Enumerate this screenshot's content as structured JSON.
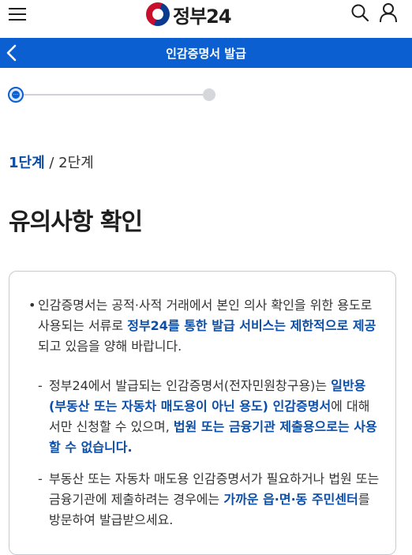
{
  "header": {
    "logo_text": "정부24",
    "menu_icon": "hamburger-menu-icon",
    "search_icon": "search-icon",
    "user_icon": "user-icon"
  },
  "titlebar": {
    "title": "인감증명서 발급",
    "back_icon": "chevron-left-icon"
  },
  "stepper": {
    "current_step": 1,
    "total_steps": 2,
    "current_symbol": "···"
  },
  "step_indicator": {
    "current": "1단계",
    "separator": " / ",
    "total": "2단계"
  },
  "page": {
    "heading": "유의사항 확인"
  },
  "notice": {
    "item1": {
      "text_a": "인감증명서는 공적·사적 거래에서 본인 의사 확인을 위한 용도로 사용되는 서류로 ",
      "highlight": "정부24를 통한 발급 서비스는 제한적으로 제공",
      "text_b": "되고 있음을 양해 바랍니다."
    },
    "sub1": {
      "text_a": "정부24에서 발급되는 인감증명서(전자민원창구용)는 ",
      "highlight_a": "일반용(부동산 또는 자동차 매도용이 아닌 용도) 인감증명서",
      "text_b": "에 대해서만 신청할 수 있으며, ",
      "highlight_b": "법원 또는 금융기관 제출용으로는 사용할 수 없습니다."
    },
    "sub2": {
      "text_a": "부동산 또는 자동차 매도용 인감증명서가 필요하거나 법원 또는 금융기관에 제출하려는 경우에는 ",
      "highlight": "가까운 읍·면·동 주민센터",
      "text_b": "를 방문하여 발급받으세요."
    }
  },
  "colors": {
    "primary": "#0b5fd1",
    "highlight_text": "#0b4ea8",
    "border": "#c7cbd1"
  }
}
